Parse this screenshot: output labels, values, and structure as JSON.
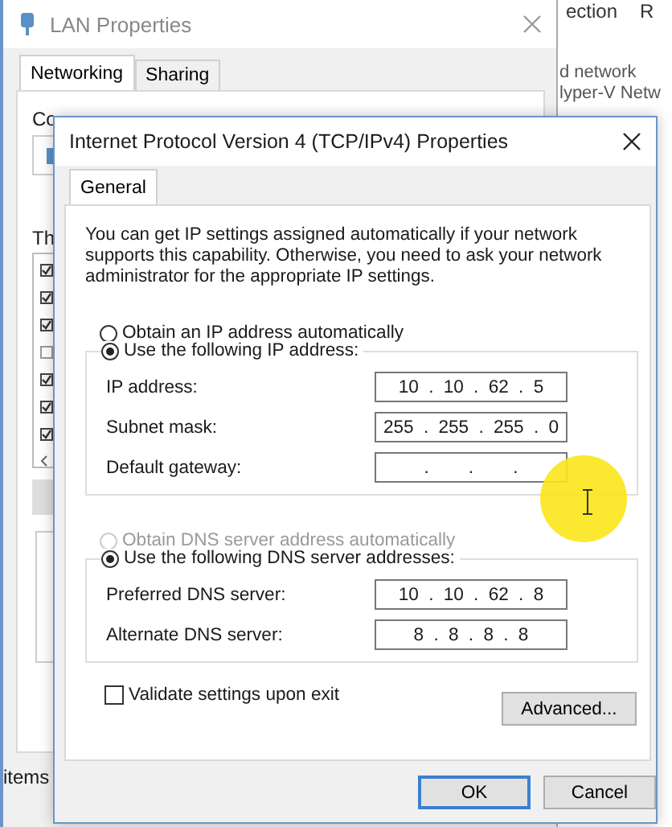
{
  "background_window": {
    "header_fragments": [
      "ection",
      "R"
    ],
    "lines": [
      "d network",
      "lyper-V Netw"
    ]
  },
  "lan_window": {
    "title": "LAN Properties",
    "tabs": [
      {
        "label": "Networking",
        "selected": true
      },
      {
        "label": "Sharing",
        "selected": false
      }
    ],
    "connect_label": "Co",
    "components_label": "Th",
    "components": [
      {
        "checked": true
      },
      {
        "checked": true
      },
      {
        "checked": true
      },
      {
        "checked": false
      },
      {
        "checked": true
      },
      {
        "checked": true
      },
      {
        "checked": true
      }
    ],
    "footer_fragment": "items"
  },
  "ipv4_dialog": {
    "title": "Internet Protocol Version 4 (TCP/IPv4) Properties",
    "tabs": [
      {
        "label": "General",
        "selected": true
      }
    ],
    "intro": "You can get IP settings assigned automatically if your network supports this capability. Otherwise, you need to ask your network administrator for the appropriate IP settings.",
    "ip_mode": [
      {
        "label": "Obtain an IP address automatically",
        "selected": false,
        "disabled": false
      },
      {
        "label": "Use the following IP address:",
        "selected": true,
        "disabled": false
      }
    ],
    "ip_fields": [
      {
        "label": "IP address:",
        "value": "10 . 10 . 62 . 5"
      },
      {
        "label": "Subnet mask:",
        "value": "255 . 255 . 255 . 0"
      },
      {
        "label": "Default gateway:",
        "value": ".    .    ."
      }
    ],
    "dns_mode": [
      {
        "label": "Obtain DNS server address automatically",
        "selected": false,
        "disabled": true
      },
      {
        "label": "Use the following DNS server addresses:",
        "selected": true,
        "disabled": false
      }
    ],
    "dns_fields": [
      {
        "label": "Preferred DNS server:",
        "value": "10 . 10 . 62 . 8"
      },
      {
        "label": "Alternate DNS server:",
        "value": "8 . 8 . 8 . 8"
      }
    ],
    "validate": {
      "label": "Validate settings upon exit",
      "checked": false
    },
    "advanced_button": "Advanced...",
    "footer_buttons": [
      {
        "label": "OK",
        "default": true
      },
      {
        "label": "Cancel",
        "default": false
      }
    ]
  }
}
